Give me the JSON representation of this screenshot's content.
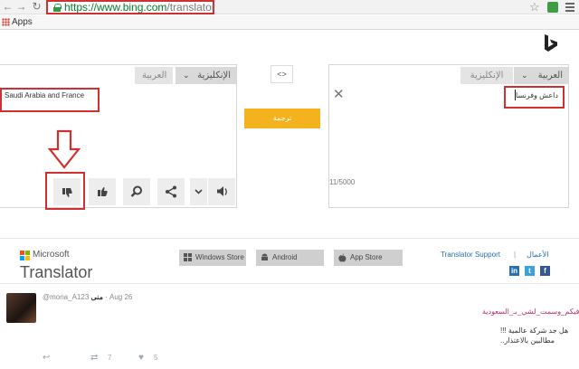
{
  "browser": {
    "url_host": "https://www.bing.com",
    "url_path": "/translator",
    "bookmarks_label": "Apps"
  },
  "translator": {
    "left_panel": {
      "lang_dropdown": "الإنكليزية",
      "lang_alt": "العربية",
      "text": "Saudi Arabia and France"
    },
    "right_panel": {
      "lang_dropdown": "العربية",
      "lang_alt": "الإنكليزية",
      "input_text": "داعش وفرنسا",
      "char_count": "11/5000"
    },
    "translate_button": "ترجمة",
    "swap_button": "<>"
  },
  "footer": {
    "ms_label": "Microsoft",
    "product_label": "Translator",
    "stores": [
      "Windows Store",
      "Android",
      "App Store"
    ],
    "support_link": "Translator Support",
    "separator": "|",
    "business_link": "الأعمال",
    "social": [
      "in",
      "t",
      "f"
    ]
  },
  "tweet": {
    "display_name": "منى",
    "handle": "@mona_A123",
    "date": "· Aug 26",
    "hashtag": "#فيكم_وسمت_لشي_بـ_السعودية",
    "line1": "هل جد شركة عالمية !!!",
    "line2": "مطالبين بالاعتذار..",
    "retweets": "7",
    "likes": "5"
  },
  "colors": {
    "highlight": "#d0302f",
    "accent": "#f4b21f",
    "link": "#2a6fb0"
  }
}
